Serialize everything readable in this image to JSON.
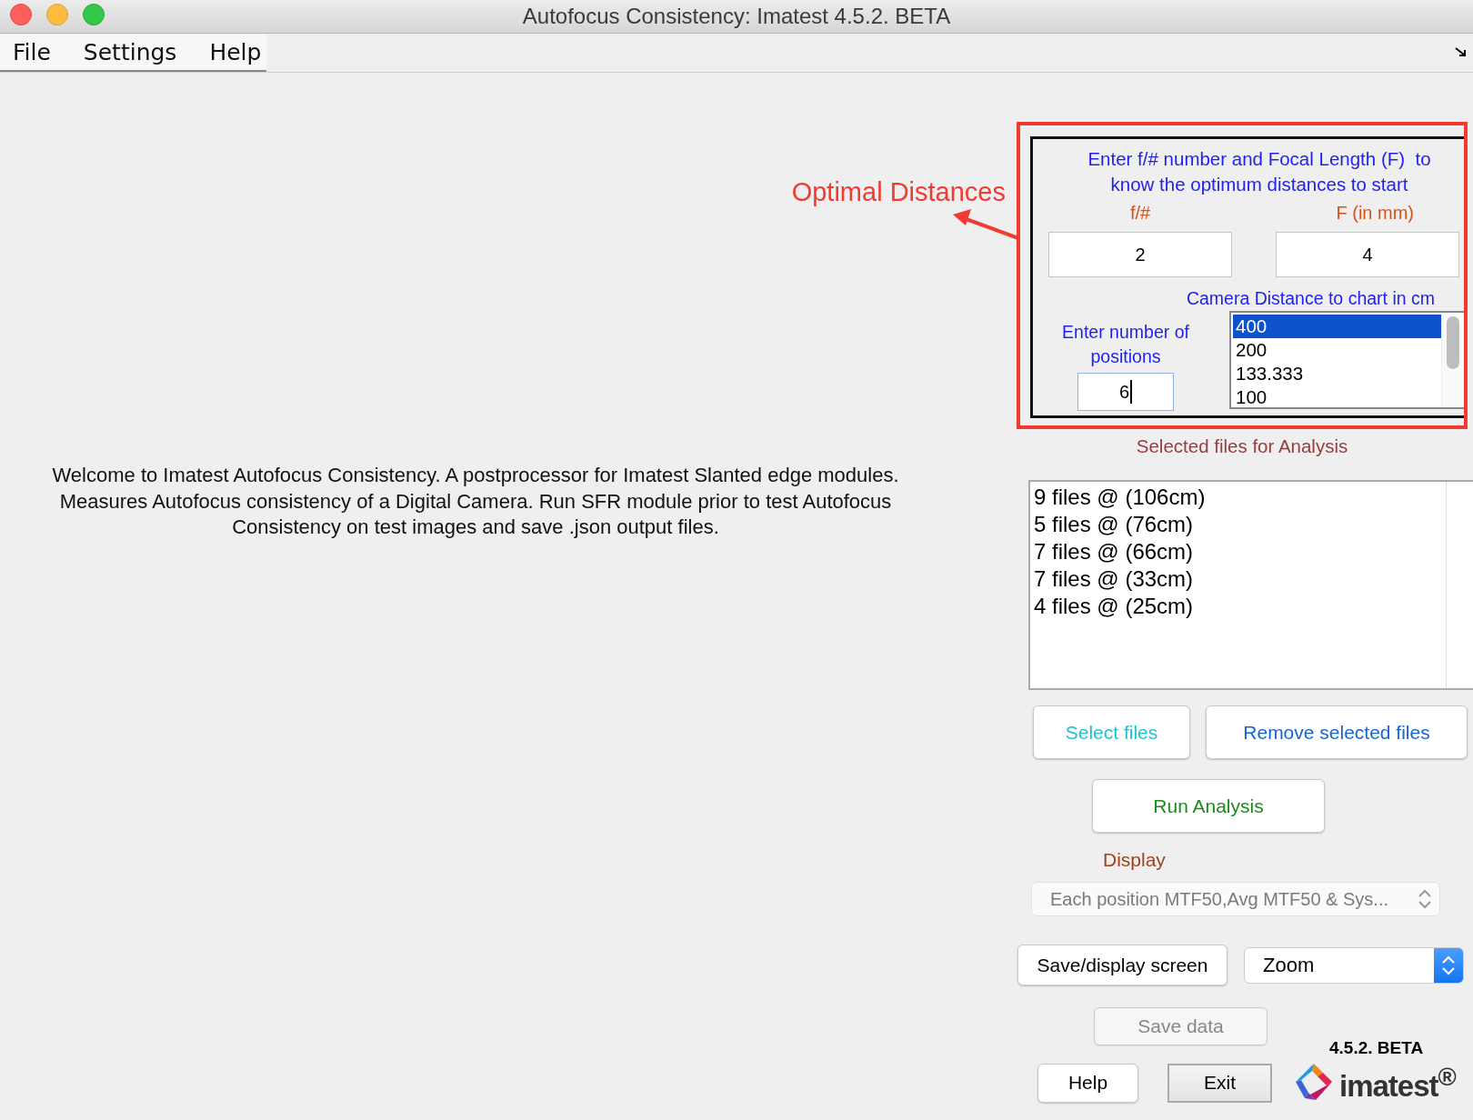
{
  "window": {
    "title": "Autofocus Consistency: Imatest 4.5.2. BETA"
  },
  "menu": [
    "File",
    "Settings",
    "Help"
  ],
  "annotation": {
    "label": "Optimal Distances"
  },
  "welcome_lines": [
    "Welcome to Imatest Autofocus Consistency. A postprocessor for Imatest Slanted edge modules.",
    "Measures Autofocus consistency of a Digital Camera. Run SFR module prior to test Autofocus",
    "Consistency on test images and save .json output files."
  ],
  "optimal_panel": {
    "instructions": "Enter f/# number and Focal Length (F)  to know the optimum distances to start",
    "f_number_label": "f/#",
    "f_number_value": "2",
    "focal_label": "F (in mm)",
    "focal_value": "4",
    "distance_label": "Camera Distance to chart in cm",
    "positions_label": "Enter number of positions",
    "positions_value": "6",
    "positions_focused": true,
    "distances": [
      {
        "value": "400",
        "selected": true
      },
      {
        "value": "200",
        "selected": false
      },
      {
        "value": "133.333",
        "selected": false
      },
      {
        "value": "100",
        "selected": false
      }
    ]
  },
  "files_label": "Selected files for Analysis",
  "files": [
    "9 files @ (106cm)",
    "5 files @ (76cm)",
    "7 files @ (66cm)",
    "7 files @ (33cm)",
    "4 files @ (25cm)"
  ],
  "select_files_button": "Select files",
  "remove_files_button": "Remove selected files",
  "run_button": "Run Analysis",
  "display_label": "Display",
  "display_select": {
    "value": "Each position MTF50,Avg MTF50 & Sys...",
    "disabled": true
  },
  "save_display_button": "Save/display screen",
  "zoom_select": {
    "value": "Zoom"
  },
  "save_data_button": {
    "label": "Save data",
    "disabled": true
  },
  "version": "4.5.2. BETA",
  "help_button": "Help",
  "exit_button": {
    "label": "Exit",
    "default": true
  },
  "logo": "imatest$^{®}$"
}
